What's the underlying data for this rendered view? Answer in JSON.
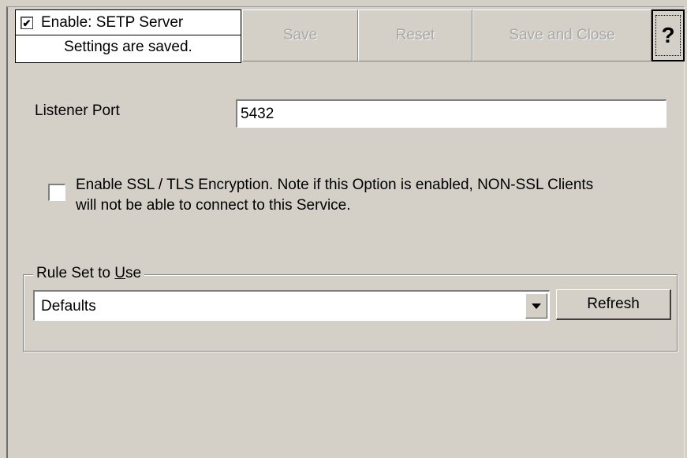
{
  "header": {
    "enable_checked": true,
    "enable_label": "Enable: SETP Server",
    "status_text": "Settings are saved.",
    "save_label": "Save",
    "reset_label": "Reset",
    "save_close_label": "Save and Close",
    "help_label": "?"
  },
  "listener": {
    "label": "Listener Port",
    "value": "5432"
  },
  "ssl": {
    "checked": false,
    "label_line1": "Enable SSL / TLS Encryption. Note if this Option is enabled, NON-SSL Clients",
    "label_line2": "will not be able to connect to this Service."
  },
  "ruleset": {
    "legend_prefix": "Rule Set to ",
    "legend_underlined": "U",
    "legend_suffix": "se",
    "selected": "Defaults",
    "refresh_label": "Refresh"
  }
}
